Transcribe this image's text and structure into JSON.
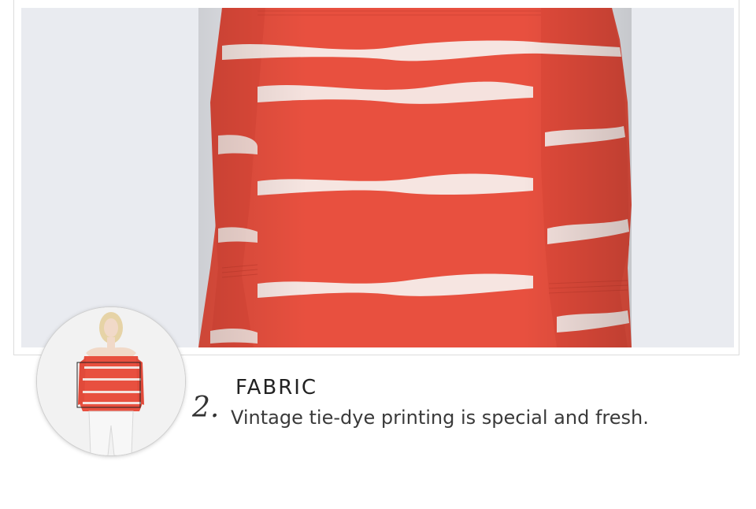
{
  "section": {
    "numeral": "2.",
    "title": "FABRIC",
    "description": "Vintage tie-dye printing is special and fresh."
  },
  "colors": {
    "fabric_red": "#e8503f",
    "stripe_white": "#f6f2ef",
    "background": "#e9ebf0"
  },
  "images": {
    "main": "close-up of red and white tie-dye off-shoulder blouse",
    "thumbnail": "model wearing red tie-dye off-shoulder blouse with white jeans"
  }
}
